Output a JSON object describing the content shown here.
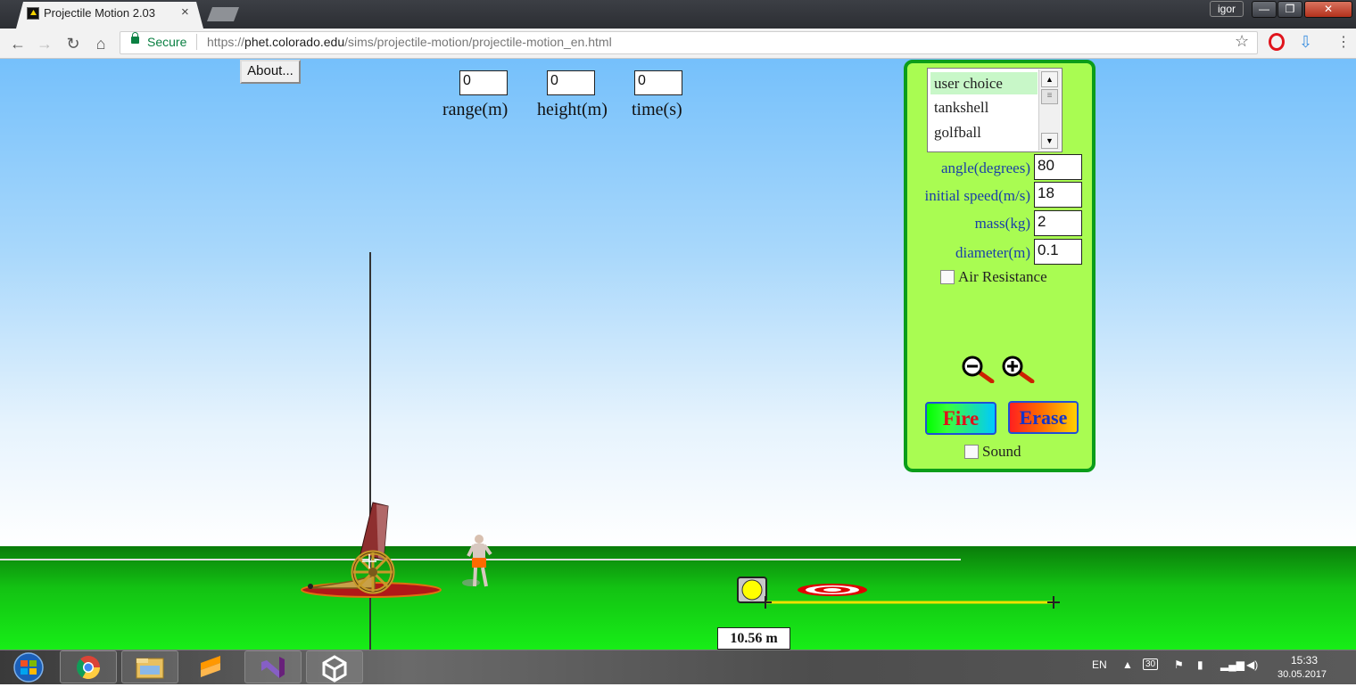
{
  "browser": {
    "tab_title": "Projectile Motion 2.03",
    "tab_close": "×",
    "profile_name": "igor",
    "window_min": "—",
    "window_max": "❐",
    "window_close": "✕",
    "nav_back": "←",
    "nav_forward": "→",
    "nav_reload": "↻",
    "nav_home": "⌂",
    "secure_label": "Secure",
    "url_scheme": "https://",
    "url_host": "phet.colorado.edu",
    "url_path": "/sims/projectile-motion/projectile-motion_en.html",
    "star": "☆",
    "download": "⇩",
    "menu": "⋮",
    "favicon_label": "PhET"
  },
  "sim": {
    "about_label": "About...",
    "readouts": [
      {
        "label": "range(m)",
        "value": "0"
      },
      {
        "label": "height(m)",
        "value": "0"
      },
      {
        "label": "time(s)",
        "value": "0"
      }
    ],
    "projectile_list": {
      "items": [
        "user choice",
        "tankshell",
        "golfball"
      ],
      "selected": "user choice"
    },
    "params": [
      {
        "label": "angle(degrees)",
        "value": "80"
      },
      {
        "label": "initial speed(m/s)",
        "value": "18"
      },
      {
        "label": "mass(kg)",
        "value": "2"
      },
      {
        "label": "diameter(m)",
        "value": "0.1"
      }
    ],
    "air_resistance_label": "Air Resistance",
    "air_resistance_checked": false,
    "fire_label": "Fire",
    "erase_label": "Erase",
    "sound_label": "Sound",
    "sound_checked": false,
    "tape_measure": "10.56 m",
    "cannon_angle_deg": 80
  },
  "taskbar": {
    "apps": [
      "chrome-icon",
      "file-explorer-icon",
      "sublime-icon",
      "visual-studio-icon",
      "unity-icon"
    ],
    "language": "EN",
    "tray_badge": "30",
    "time": "15:33",
    "date": "30.05.2017"
  },
  "colors": {
    "panel_bg": "#a9fc52",
    "panel_border": "#0b9d1a",
    "param_label": "#1a3fa8",
    "fire_text": "#e0101a",
    "erase_text": "#1434c8"
  }
}
